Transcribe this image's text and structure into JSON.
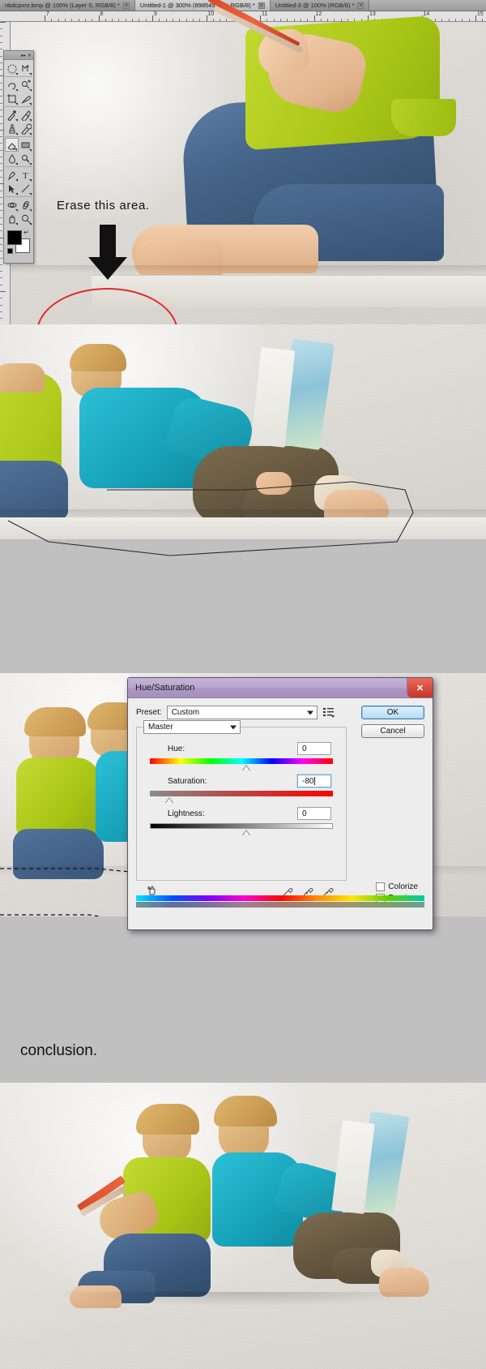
{
  "app": {
    "name": "Adobe Photoshop",
    "tabs": [
      {
        "label": "nbdcpxnr.bmp @ 100% (Layer 0, RGB/8) *",
        "close": "✕",
        "active": false
      },
      {
        "label": "Untitled-1 @ 300% (898545_low, RGB/8) *",
        "close": "✕",
        "active": true
      },
      {
        "label": "Untitled-3 @ 100% (RGB/8) *",
        "close": "✕",
        "active": false
      }
    ],
    "ruler": {
      "unit": "inches",
      "horizontal_labels": [
        "7",
        "8",
        "9",
        "10",
        "11",
        "12",
        "13",
        "14",
        "15"
      ]
    },
    "toolbox": {
      "title_controls": [
        "▸▸",
        "✕"
      ],
      "tools": [
        "marquee-tool",
        "move-tool",
        "lasso-tool",
        "quick-selection-tool",
        "crop-tool",
        "eyedropper-tool",
        "healing-brush-tool",
        "brush-tool",
        "clone-stamp-tool",
        "history-brush-tool",
        "eraser-tool",
        "gradient-tool",
        "blur-tool",
        "dodge-tool",
        "pen-tool",
        "horizontal-type-tool",
        "path-selection-tool",
        "line-tool",
        "3d-rotate-tool",
        "3d-orbit-tool",
        "hand-tool",
        "zoom-tool"
      ],
      "selected_tool": "eraser-tool",
      "foreground_color": "#000000",
      "background_color": "#ffffff"
    }
  },
  "step1": {
    "annotation": "Erase this area.",
    "arrow_icon": "down-arrow-icon",
    "highlight_shape": "red-ellipse",
    "highlight_color": "#e2282a"
  },
  "step2": {
    "selection_outline": "polygonal-lasso-path"
  },
  "dialog": {
    "title": "Hue/Saturation",
    "close_label": "✕",
    "preset_label": "Preset:",
    "preset_value": "Custom",
    "preset_menu_icon": "preset-options-icon",
    "channel_value": "Master",
    "buttons": {
      "ok": "OK",
      "cancel": "Cancel"
    },
    "sliders": [
      {
        "label": "Hue:",
        "value": "0",
        "thumb_pct": 50,
        "focused": false
      },
      {
        "label": "Saturation:",
        "value": "-80",
        "thumb_pct": 10,
        "focused": true
      },
      {
        "label": "Lightness:",
        "value": "0",
        "thumb_pct": 50,
        "focused": false
      }
    ],
    "footer": {
      "hand_icon": "on-image-adjustment-icon",
      "eyedroppers": [
        "eyedropper-icon",
        "eyedropper-plus-icon",
        "eyedropper-minus-icon"
      ],
      "colorize_label": "Colorize",
      "colorize_checked": false,
      "preview_label": "Preview",
      "preview_checked": true,
      "preview_check_glyph": "✓"
    },
    "title_color": "#b9a6cd",
    "close_color": "#d8402f",
    "accent_color": "#3f7fb0"
  },
  "step4": {
    "caption": "conclusion."
  },
  "palette": {
    "shirt_green": "#b4cf22",
    "shirt_teal": "#1fa9bf",
    "jeans_blue": "#3f618a",
    "pants_brown": "#6e6047",
    "skin": "#eec6a2",
    "hair_blond": "#d8ae63",
    "workspace_gray": "#c0c0c0"
  }
}
